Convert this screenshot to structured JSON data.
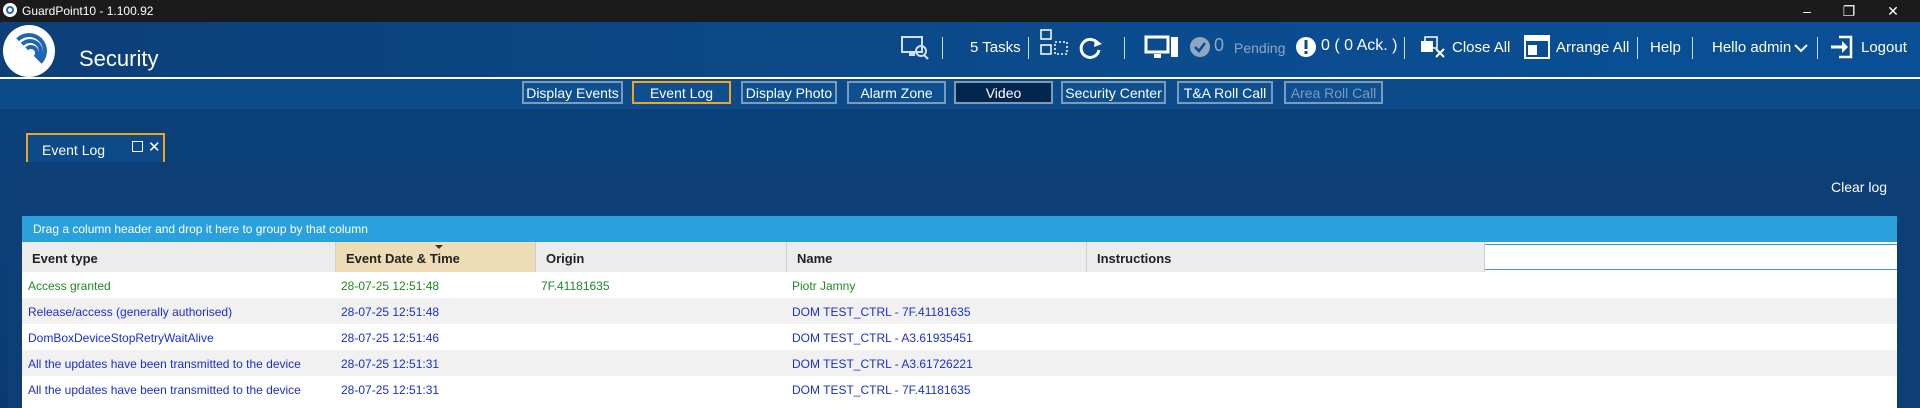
{
  "window": {
    "title": "GuardPoint10 - 1.100.92"
  },
  "header": {
    "app_title": "Security",
    "tasks_label": "5 Tasks",
    "pending_count": "0",
    "pending_label": "Pending",
    "ack_text": "0 ( 0  Ack. )",
    "close_all_label": "Close All",
    "arrange_all_label": "Arrange All",
    "help_label": "Help",
    "user_label": "Hello admin",
    "logout_label": "Logout"
  },
  "nav": {
    "buttons": [
      {
        "label": "Display Events"
      },
      {
        "label": "Event Log"
      },
      {
        "label": "Display Photo"
      },
      {
        "label": "Alarm Zone"
      },
      {
        "label": "Video"
      },
      {
        "label": "Security Center"
      },
      {
        "label": "T&A Roll Call"
      },
      {
        "label": "Area Roll Call"
      }
    ],
    "active": "Event Log"
  },
  "doc_tab": {
    "label": "Event Log"
  },
  "panel": {
    "clear_log_label": "Clear log",
    "group_hint": "Drag a column header and drop it here to group by that column"
  },
  "grid": {
    "columns": [
      "Event type",
      "Event Date & Time",
      "Origin",
      "Name",
      "Instructions"
    ],
    "sorted_column": "Event Date & Time",
    "rows": [
      {
        "type": "Access granted",
        "datetime": "28-07-25 12:51:48",
        "origin": "7F.41181635",
        "name": "Piotr Jamny",
        "instructions": ""
      },
      {
        "type": "Release/access (generally authorised)",
        "datetime": "28-07-25 12:51:48",
        "origin": "",
        "name": "DOM TEST_CTRL - 7F.41181635",
        "instructions": ""
      },
      {
        "type": "DomBoxDeviceStopRetryWaitAlive",
        "datetime": "28-07-25 12:51:46",
        "origin": "",
        "name": "DOM TEST_CTRL - A3.61935451",
        "instructions": ""
      },
      {
        "type": "All the updates have been transmitted to the device",
        "datetime": "28-07-25 12:51:31",
        "origin": "",
        "name": "DOM TEST_CTRL - A3.61726221",
        "instructions": ""
      },
      {
        "type": "All the updates have been transmitted to the device",
        "datetime": "28-07-25 12:51:31",
        "origin": "",
        "name": "DOM TEST_CTRL - 7F.41181635",
        "instructions": ""
      }
    ]
  },
  "colors": {
    "accent_orange": "#f3a41e",
    "header_blue": "#0b4c8e",
    "group_panel": "#2aa1dd",
    "granted_green": "#1f8a1f",
    "event_blue": "#1a2fd0"
  }
}
